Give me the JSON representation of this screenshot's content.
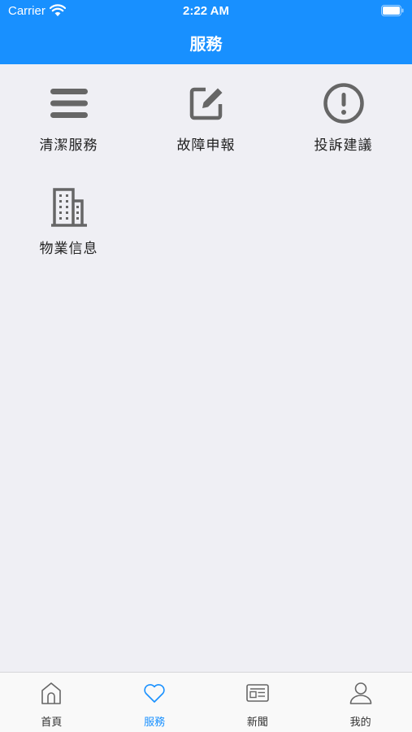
{
  "status_bar": {
    "carrier": "Carrier",
    "time": "2:22 AM"
  },
  "nav": {
    "title": "服務"
  },
  "services": [
    {
      "label": "清潔服務",
      "icon": "list-icon"
    },
    {
      "label": "故障申報",
      "icon": "edit-icon"
    },
    {
      "label": "投訴建議",
      "icon": "alert-circle-icon"
    },
    {
      "label": "物業信息",
      "icon": "building-icon"
    }
  ],
  "tabs": [
    {
      "label": "首頁",
      "icon": "home-icon",
      "active": false
    },
    {
      "label": "服務",
      "icon": "heart-icon",
      "active": true
    },
    {
      "label": "新聞",
      "icon": "newspaper-icon",
      "active": false
    },
    {
      "label": "我的",
      "icon": "user-icon",
      "active": false
    }
  ],
  "colors": {
    "primary": "#1890FF",
    "background": "#EFEFF4",
    "icon_gray": "#666666",
    "tab_inactive": "#333333"
  }
}
